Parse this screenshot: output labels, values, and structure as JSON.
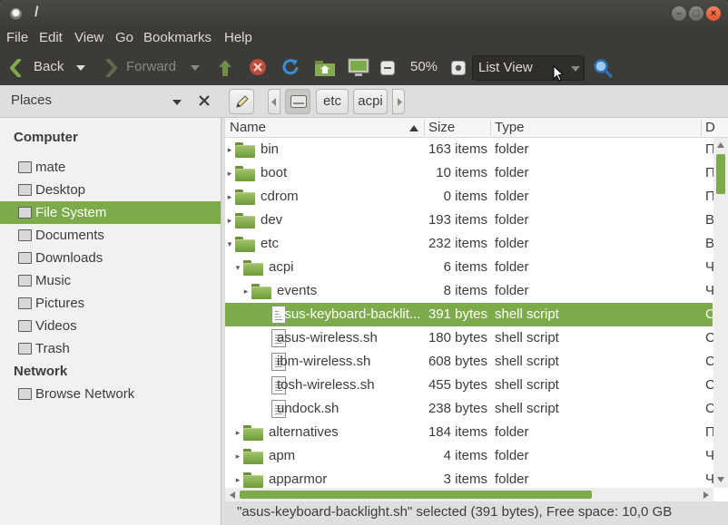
{
  "window": {
    "title": "/"
  },
  "menu": [
    "File",
    "Edit",
    "View",
    "Go",
    "Bookmarks",
    "Help"
  ],
  "toolbar": {
    "back_label": "Back",
    "forward_label": "Forward",
    "zoom": "50%",
    "view_mode": "List View"
  },
  "pathbar": {
    "places_label": "Places",
    "crumbs": [
      "etc",
      "acpi"
    ]
  },
  "sidebar": {
    "computer_heading": "Computer",
    "network_heading": "Network",
    "items": [
      {
        "label": "mate",
        "icon": "home-folder-icon"
      },
      {
        "label": "Desktop",
        "icon": "desktop-icon"
      },
      {
        "label": "File System",
        "icon": "harddrive-icon",
        "selected": true
      },
      {
        "label": "Documents",
        "icon": "documents-folder-icon"
      },
      {
        "label": "Downloads",
        "icon": "downloads-folder-icon"
      },
      {
        "label": "Music",
        "icon": "music-folder-icon"
      },
      {
        "label": "Pictures",
        "icon": "pictures-folder-icon"
      },
      {
        "label": "Videos",
        "icon": "videos-folder-icon"
      },
      {
        "label": "Trash",
        "icon": "trash-icon"
      }
    ],
    "network_items": [
      {
        "label": "Browse Network",
        "icon": "network-icon"
      }
    ]
  },
  "columns": {
    "name": "Name",
    "size": "Size",
    "type": "Type",
    "date": "D"
  },
  "rows": [
    {
      "name": "bin",
      "size": "163 items",
      "type": "folder",
      "date": "П",
      "kind": "folder",
      "level": 0,
      "expander": "collapsed"
    },
    {
      "name": "boot",
      "size": "10 items",
      "type": "folder",
      "date": "П",
      "kind": "folder",
      "level": 0,
      "expander": "collapsed"
    },
    {
      "name": "cdrom",
      "size": "0 items",
      "type": "folder",
      "date": "П",
      "kind": "folder",
      "level": 0,
      "expander": "collapsed"
    },
    {
      "name": "dev",
      "size": "193 items",
      "type": "folder",
      "date": "В",
      "kind": "folder",
      "level": 0,
      "expander": "collapsed"
    },
    {
      "name": "etc",
      "size": "232 items",
      "type": "folder",
      "date": "В",
      "kind": "folder",
      "level": 0,
      "expander": "expanded"
    },
    {
      "name": "acpi",
      "size": "6 items",
      "type": "folder",
      "date": "Ч",
      "kind": "folder",
      "level": 1,
      "expander": "expanded"
    },
    {
      "name": "events",
      "size": "8 items",
      "type": "folder",
      "date": "Ч",
      "kind": "folder",
      "level": 2,
      "expander": "collapsed"
    },
    {
      "name": "asus-keyboard-backlit...",
      "size": "391 bytes",
      "type": "shell script",
      "date": "С",
      "kind": "file",
      "level": 2,
      "expander": "none",
      "selected": true
    },
    {
      "name": "asus-wireless.sh",
      "size": "180 bytes",
      "type": "shell script",
      "date": "С",
      "kind": "file",
      "level": 2,
      "expander": "none"
    },
    {
      "name": "ibm-wireless.sh",
      "size": "608 bytes",
      "type": "shell script",
      "date": "С",
      "kind": "file",
      "level": 2,
      "expander": "none"
    },
    {
      "name": "tosh-wireless.sh",
      "size": "455 bytes",
      "type": "shell script",
      "date": "С",
      "kind": "file",
      "level": 2,
      "expander": "none"
    },
    {
      "name": "undock.sh",
      "size": "238 bytes",
      "type": "shell script",
      "date": "С",
      "kind": "file",
      "level": 2,
      "expander": "none"
    },
    {
      "name": "alternatives",
      "size": "184 items",
      "type": "folder",
      "date": "П",
      "kind": "folder",
      "level": 1,
      "expander": "collapsed"
    },
    {
      "name": "apm",
      "size": "4 items",
      "type": "folder",
      "date": "Ч",
      "kind": "folder",
      "level": 1,
      "expander": "collapsed"
    },
    {
      "name": "apparmor",
      "size": "3 items",
      "type": "folder",
      "date": "Ч",
      "kind": "folder",
      "level": 1,
      "expander": "collapsed"
    }
  ],
  "status": "\"asus-keyboard-backlight.sh\" selected (391 bytes), Free space: 10,0 GB",
  "colors": {
    "accent": "#7dab4c",
    "chrome": "#3c3b37"
  }
}
